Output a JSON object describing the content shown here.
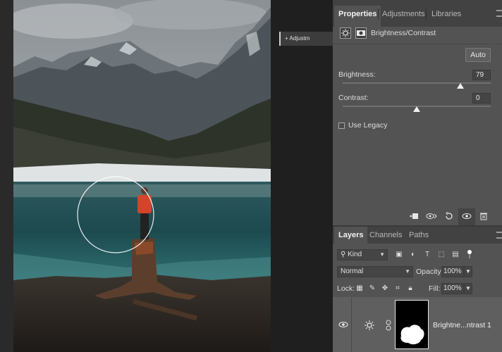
{
  "canvas": {
    "collapsed_panel_label": "+ Adjustm"
  },
  "properties": {
    "tabs": [
      "Properties",
      "Adjustments",
      "Libraries"
    ],
    "active_tab": "Properties",
    "adjustment_title": "Brightness/Contrast",
    "auto_label": "Auto",
    "brightness_label": "Brightness:",
    "brightness_value": "79",
    "brightness_level": 0.795,
    "contrast_label": "Contrast:",
    "contrast_value": "0",
    "contrast_level": 0.5,
    "legacy_label": "Use Legacy",
    "legacy_checked": false,
    "footer_icons": [
      "clip-to-layer-icon",
      "view-previous-icon",
      "reset-icon",
      "visibility-icon",
      "trash-icon"
    ]
  },
  "layers": {
    "tabs": [
      "Layers",
      "Channels",
      "Paths"
    ],
    "active_tab": "Layers",
    "filter_kind": "Kind",
    "blend_mode": "Normal",
    "opacity_label": "Opacity:",
    "opacity_value": "100%",
    "lock_label": "Lock:",
    "fill_label": "Fill:",
    "fill_value": "100%",
    "layer_name": "Brightne...ntrast 1"
  },
  "colors": {
    "panel_bg": "#535353",
    "tabbar_bg": "#424242",
    "canvas_bg": "#1f1f1f",
    "layer_selected": "#5f5f5f"
  }
}
